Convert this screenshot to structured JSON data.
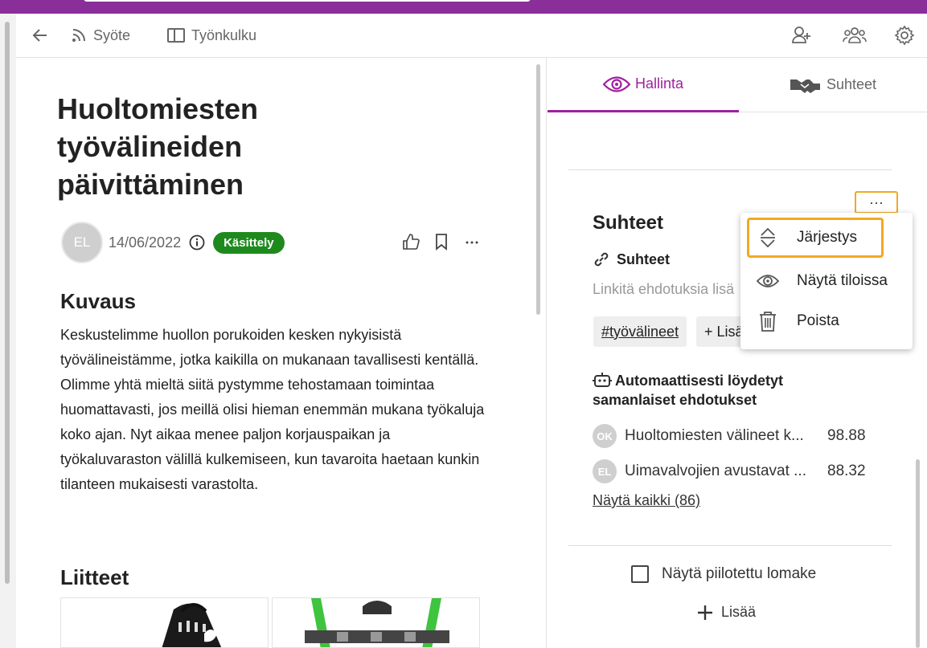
{
  "nav": {
    "feed_label": "Syöte",
    "workflow_label": "Työnkulku"
  },
  "idea": {
    "title": "Huoltomiesten työvälineiden päivittäminen",
    "author_initials": "EL",
    "date": "14/06/2022",
    "status": "Käsittely",
    "status_color": "#1e8a1e",
    "description_heading": "Kuvaus",
    "description": "Keskustelimme huollon porukoiden kesken nykyisistä työvälineistämme, jotka kaikilla on mukanaan tavallisesti kentällä. Olimme yhtä mieltä siitä pystymme tehostamaan toimintaa huomattavasti, jos meillä olisi hieman enemmän mukana työkaluja koko ajan. Nyt aikaa menee paljon korjauspaikan ja työkaluvaraston välillä kulkemiseen, kun tavaroita haetaan kunkin tilanteen mukaisesti varastolta.",
    "attachments_heading": "Liitteet"
  },
  "panel": {
    "tab_manage": "Hallinta",
    "tab_relations": "Suhteet",
    "accent_color": "#a020a0",
    "section_title": "Suhteet",
    "links_title": "Suhteet",
    "links_hint": "Linkitä ehdotuksia lisä",
    "tag": "#työvälineet",
    "add_tag": "+ Lisä",
    "similar_title": "Automaattisesti löydetyt samanlaiset ehdotukset",
    "similar": [
      {
        "initials": "OK",
        "title": "Huoltomiesten välineet k...",
        "score": "98.88"
      },
      {
        "initials": "EL",
        "title": "Uimavalvojien avustavat ...",
        "score": "88.32"
      }
    ],
    "show_all": "Näytä kaikki (86)",
    "show_hidden_form": "Näytä piilotettu lomake",
    "add_label": "Lisää"
  },
  "menu": {
    "dots": "···",
    "items": [
      {
        "label": "Järjestys",
        "icon": "sort-icon"
      },
      {
        "label": "Näytä tiloissa",
        "icon": "eye-icon"
      },
      {
        "label": "Poista",
        "icon": "trash-icon"
      }
    ],
    "highlight_color": "#f3a821"
  }
}
